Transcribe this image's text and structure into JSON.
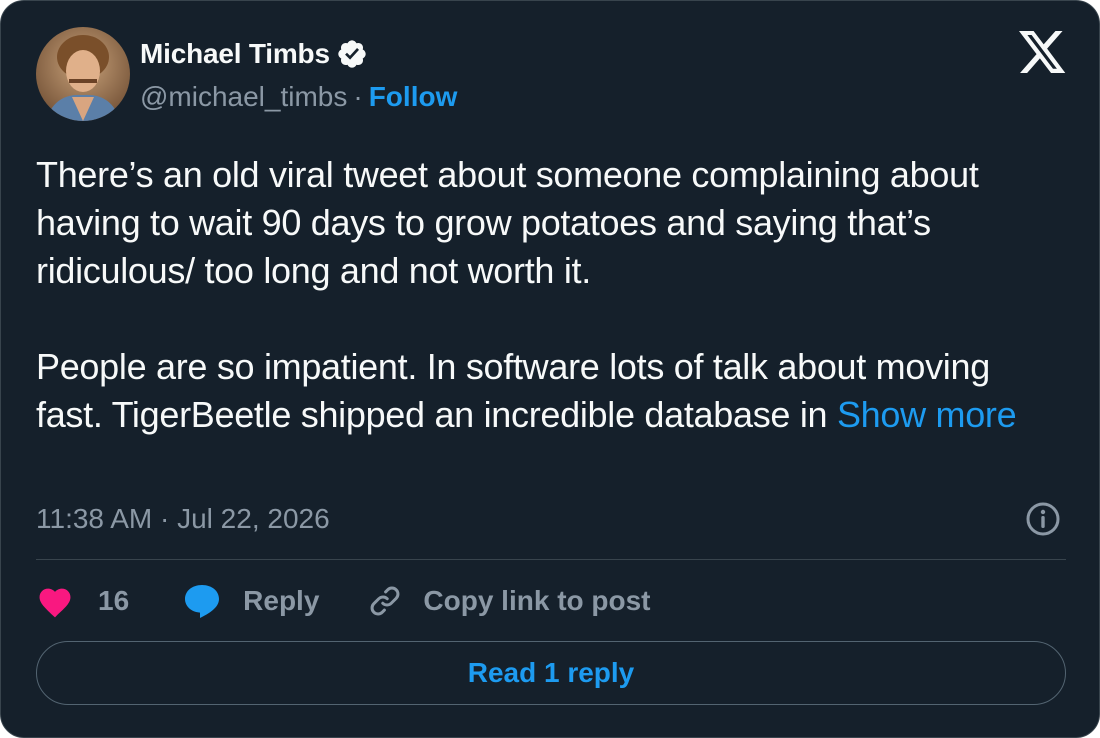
{
  "author": {
    "name": "Michael Timbs",
    "handle": "@michael_timbs",
    "separator": "·",
    "follow_label": "Follow"
  },
  "tweet": {
    "text": "There’s an old viral tweet about someone complaining about having to wait 90 days to grow potatoes and saying that’s ridiculous/ too long and not worth it.\n\nPeople are so impatient. In software lots of talk about moving fast. TigerBeetle shipped an incredible database in ",
    "show_more_label": "Show more",
    "timestamp": "11:38 AM · Jul 22, 2026"
  },
  "actions": {
    "like_count": "16",
    "reply_label": "Reply",
    "copy_link_label": "Copy link to post"
  },
  "read_reply_label": "Read 1 reply",
  "icons": {
    "verified": "verified-badge-icon",
    "brand": "x-logo-icon",
    "info": "info-icon",
    "like": "heart-icon",
    "reply": "speech-bubble-icon",
    "copy": "link-icon"
  },
  "colors": {
    "background": "#15202b",
    "text": "#f7f9f9",
    "muted": "#8b98a5",
    "accent": "#1d9bf0",
    "like": "#f91880",
    "border": "#38444d"
  }
}
